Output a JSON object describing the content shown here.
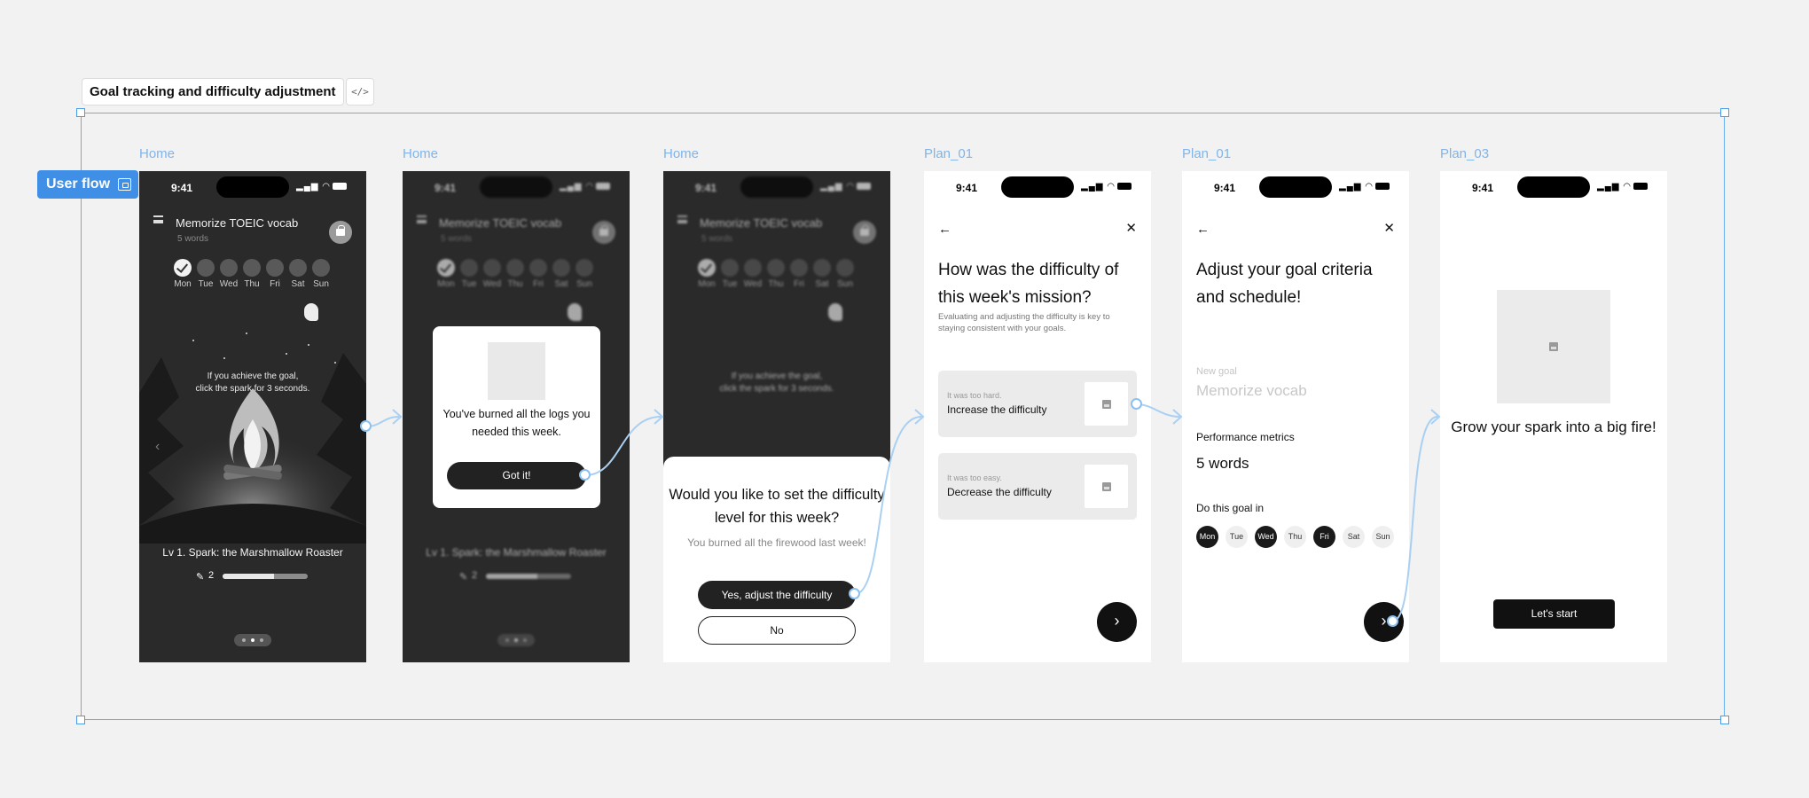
{
  "canvas": {
    "section_title": "Goal tracking and difficulty adjustment",
    "code_button_label": "</>",
    "flow_tag": "User flow",
    "accent_color": "#3f8fe6"
  },
  "frames": [
    {
      "label": "Home"
    },
    {
      "label": "Home"
    },
    {
      "label": "Home"
    },
    {
      "label": "Plan_01"
    },
    {
      "label": "Plan_01"
    },
    {
      "label": "Plan_03"
    }
  ],
  "status": {
    "time": "9:41",
    "icons": "signal-icon wifi-icon battery-icon"
  },
  "home": {
    "goal_title": "Memorize TOEIC vocab",
    "goal_sub": "5 words",
    "days": [
      "Mon",
      "Tue",
      "Wed",
      "Thu",
      "Fri",
      "Sat",
      "Sun"
    ],
    "completed_days": [
      "Mon"
    ],
    "hint_line1": "If you achieve the goal,",
    "hint_line2": "click the spark for 3 seconds.",
    "level_title": "Lv 1. Spark: the Marshmallow Roaster",
    "log_count": "2",
    "progress": 0.6
  },
  "modal": {
    "text": "You've burned all the logs you needed this week.",
    "button": "Got it!"
  },
  "sheet": {
    "title": "Would you like to set the difficulty level for this week?",
    "subtitle": "You burned all the firewood last week!",
    "yes_button": "Yes, adjust the difficulty",
    "no_button": "No"
  },
  "plan01a": {
    "back": "←",
    "close": "✕",
    "title": "How was the difficulty of this week's mission?",
    "desc": "Evaluating and adjusting the difficulty is key to staying consistent with your goals.",
    "options": [
      {
        "label": "It was too hard.",
        "text": "Increase the difficulty"
      },
      {
        "label": "It was too easy.",
        "text": "Decrease the difficulty"
      }
    ],
    "next": "›"
  },
  "plan01b": {
    "back": "←",
    "close": "✕",
    "title": "Adjust your goal criteria and schedule!",
    "new_goal_label": "New goal",
    "new_goal_placeholder": "Memorize vocab",
    "metrics_label": "Performance metrics",
    "metrics_value": "5 words",
    "do_label": "Do this goal in",
    "days": [
      "Mon",
      "Tue",
      "Wed",
      "Thu",
      "Fri",
      "Sat",
      "Sun"
    ],
    "selected_days": [
      "Mon",
      "Wed",
      "Fri"
    ],
    "next": "›"
  },
  "plan03": {
    "title": "Grow your spark into a big fire!",
    "start_button": "Let's start"
  }
}
